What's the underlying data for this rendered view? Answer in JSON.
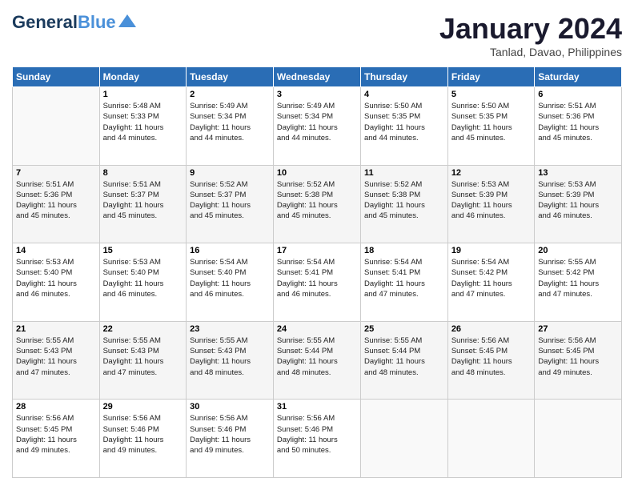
{
  "logo": {
    "part1": "General",
    "part2": "Blue"
  },
  "title": "January 2024",
  "location": "Tanlad, Davao, Philippines",
  "days_of_week": [
    "Sunday",
    "Monday",
    "Tuesday",
    "Wednesday",
    "Thursday",
    "Friday",
    "Saturday"
  ],
  "weeks": [
    [
      {
        "day": "",
        "info": ""
      },
      {
        "day": "1",
        "info": "Sunrise: 5:48 AM\nSunset: 5:33 PM\nDaylight: 11 hours\nand 44 minutes."
      },
      {
        "day": "2",
        "info": "Sunrise: 5:49 AM\nSunset: 5:34 PM\nDaylight: 11 hours\nand 44 minutes."
      },
      {
        "day": "3",
        "info": "Sunrise: 5:49 AM\nSunset: 5:34 PM\nDaylight: 11 hours\nand 44 minutes."
      },
      {
        "day": "4",
        "info": "Sunrise: 5:50 AM\nSunset: 5:35 PM\nDaylight: 11 hours\nand 44 minutes."
      },
      {
        "day": "5",
        "info": "Sunrise: 5:50 AM\nSunset: 5:35 PM\nDaylight: 11 hours\nand 45 minutes."
      },
      {
        "day": "6",
        "info": "Sunrise: 5:51 AM\nSunset: 5:36 PM\nDaylight: 11 hours\nand 45 minutes."
      }
    ],
    [
      {
        "day": "7",
        "info": "Sunrise: 5:51 AM\nSunset: 5:36 PM\nDaylight: 11 hours\nand 45 minutes."
      },
      {
        "day": "8",
        "info": "Sunrise: 5:51 AM\nSunset: 5:37 PM\nDaylight: 11 hours\nand 45 minutes."
      },
      {
        "day": "9",
        "info": "Sunrise: 5:52 AM\nSunset: 5:37 PM\nDaylight: 11 hours\nand 45 minutes."
      },
      {
        "day": "10",
        "info": "Sunrise: 5:52 AM\nSunset: 5:38 PM\nDaylight: 11 hours\nand 45 minutes."
      },
      {
        "day": "11",
        "info": "Sunrise: 5:52 AM\nSunset: 5:38 PM\nDaylight: 11 hours\nand 45 minutes."
      },
      {
        "day": "12",
        "info": "Sunrise: 5:53 AM\nSunset: 5:39 PM\nDaylight: 11 hours\nand 46 minutes."
      },
      {
        "day": "13",
        "info": "Sunrise: 5:53 AM\nSunset: 5:39 PM\nDaylight: 11 hours\nand 46 minutes."
      }
    ],
    [
      {
        "day": "14",
        "info": "Sunrise: 5:53 AM\nSunset: 5:40 PM\nDaylight: 11 hours\nand 46 minutes."
      },
      {
        "day": "15",
        "info": "Sunrise: 5:53 AM\nSunset: 5:40 PM\nDaylight: 11 hours\nand 46 minutes."
      },
      {
        "day": "16",
        "info": "Sunrise: 5:54 AM\nSunset: 5:40 PM\nDaylight: 11 hours\nand 46 minutes."
      },
      {
        "day": "17",
        "info": "Sunrise: 5:54 AM\nSunset: 5:41 PM\nDaylight: 11 hours\nand 46 minutes."
      },
      {
        "day": "18",
        "info": "Sunrise: 5:54 AM\nSunset: 5:41 PM\nDaylight: 11 hours\nand 47 minutes."
      },
      {
        "day": "19",
        "info": "Sunrise: 5:54 AM\nSunset: 5:42 PM\nDaylight: 11 hours\nand 47 minutes."
      },
      {
        "day": "20",
        "info": "Sunrise: 5:55 AM\nSunset: 5:42 PM\nDaylight: 11 hours\nand 47 minutes."
      }
    ],
    [
      {
        "day": "21",
        "info": "Sunrise: 5:55 AM\nSunset: 5:43 PM\nDaylight: 11 hours\nand 47 minutes."
      },
      {
        "day": "22",
        "info": "Sunrise: 5:55 AM\nSunset: 5:43 PM\nDaylight: 11 hours\nand 47 minutes."
      },
      {
        "day": "23",
        "info": "Sunrise: 5:55 AM\nSunset: 5:43 PM\nDaylight: 11 hours\nand 48 minutes."
      },
      {
        "day": "24",
        "info": "Sunrise: 5:55 AM\nSunset: 5:44 PM\nDaylight: 11 hours\nand 48 minutes."
      },
      {
        "day": "25",
        "info": "Sunrise: 5:55 AM\nSunset: 5:44 PM\nDaylight: 11 hours\nand 48 minutes."
      },
      {
        "day": "26",
        "info": "Sunrise: 5:56 AM\nSunset: 5:45 PM\nDaylight: 11 hours\nand 48 minutes."
      },
      {
        "day": "27",
        "info": "Sunrise: 5:56 AM\nSunset: 5:45 PM\nDaylight: 11 hours\nand 49 minutes."
      }
    ],
    [
      {
        "day": "28",
        "info": "Sunrise: 5:56 AM\nSunset: 5:45 PM\nDaylight: 11 hours\nand 49 minutes."
      },
      {
        "day": "29",
        "info": "Sunrise: 5:56 AM\nSunset: 5:46 PM\nDaylight: 11 hours\nand 49 minutes."
      },
      {
        "day": "30",
        "info": "Sunrise: 5:56 AM\nSunset: 5:46 PM\nDaylight: 11 hours\nand 49 minutes."
      },
      {
        "day": "31",
        "info": "Sunrise: 5:56 AM\nSunset: 5:46 PM\nDaylight: 11 hours\nand 50 minutes."
      },
      {
        "day": "",
        "info": ""
      },
      {
        "day": "",
        "info": ""
      },
      {
        "day": "",
        "info": ""
      }
    ]
  ]
}
